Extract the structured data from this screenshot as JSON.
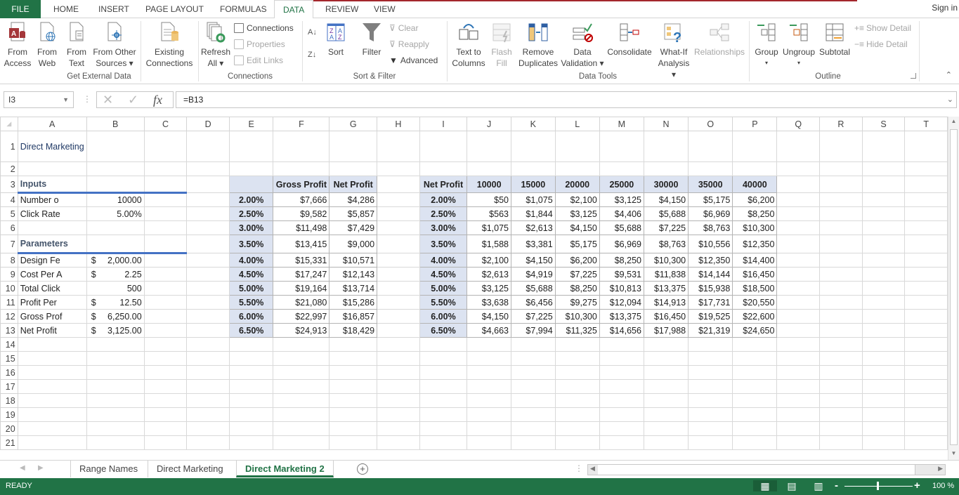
{
  "ribbon_tabs": [
    "FILE",
    "HOME",
    "INSERT",
    "PAGE LAYOUT",
    "FORMULAS",
    "DATA",
    "REVIEW",
    "VIEW"
  ],
  "active_tab": "DATA",
  "sign_in": "Sign in",
  "ribbon": {
    "get_external_data": {
      "label": "Get External Data",
      "from_access": [
        "From",
        "Access"
      ],
      "from_web": [
        "From",
        "Web"
      ],
      "from_text": [
        "From",
        "Text"
      ],
      "from_other": [
        "From Other",
        "Sources ▾"
      ],
      "existing": [
        "Existing",
        "Connections"
      ]
    },
    "connections": {
      "label": "Connections",
      "refresh_all": [
        "Refresh",
        "All ▾"
      ],
      "connections": "Connections",
      "properties": "Properties",
      "edit_links": "Edit Links"
    },
    "sort_filter": {
      "label": "Sort & Filter",
      "sort": "Sort",
      "filter": "Filter",
      "clear": "Clear",
      "reapply": "Reapply",
      "advanced": "Advanced"
    },
    "data_tools": {
      "label": "Data Tools",
      "text_to_columns": [
        "Text to",
        "Columns"
      ],
      "flash_fill": [
        "Flash",
        "Fill"
      ],
      "remove_duplicates": [
        "Remove",
        "Duplicates"
      ],
      "data_validation": [
        "Data",
        "Validation ▾"
      ],
      "consolidate": "Consolidate",
      "what_if": [
        "What-If",
        "Analysis ▾"
      ],
      "relationships": "Relationships"
    },
    "outline": {
      "label": "Outline",
      "group": [
        "Group",
        "▾"
      ],
      "ungroup": [
        "Ungroup",
        "▾"
      ],
      "subtotal": "Subtotal",
      "show_detail": "Show Detail",
      "hide_detail": "Hide Detail"
    }
  },
  "formula_bar": {
    "name_box": "I3",
    "formula": "=B13"
  },
  "columns": [
    "A",
    "B",
    "C",
    "D",
    "E",
    "F",
    "G",
    "H",
    "I",
    "J",
    "K",
    "L",
    "M",
    "N",
    "O",
    "P",
    "Q",
    "R",
    "S",
    "T"
  ],
  "rows": [
    "1",
    "2",
    "3",
    "4",
    "5",
    "6",
    "7",
    "8",
    "9",
    "10",
    "11",
    "12",
    "13",
    "14",
    "15",
    "16",
    "17",
    "18",
    "19",
    "20",
    "21"
  ],
  "sheet": {
    "title": "Direct Marketing",
    "inputs_header": "Inputs",
    "inputs": [
      {
        "label": "Number o",
        "dollar": "",
        "value": "10000"
      },
      {
        "label": "Click Rate",
        "dollar": "",
        "value": "5.00%"
      }
    ],
    "parameters_header": "Parameters",
    "parameters": [
      {
        "label": "Design Fe",
        "dollar": "$",
        "value": "2,000.00"
      },
      {
        "label": "Cost Per A",
        "dollar": "$",
        "value": "2.25"
      },
      {
        "label": "Total Click",
        "dollar": "",
        "value": "500"
      },
      {
        "label": "Profit Per",
        "dollar": "$",
        "value": "12.50"
      },
      {
        "label": "Gross Prof",
        "dollar": "$",
        "value": "6,250.00"
      },
      {
        "label": "Net Profit",
        "dollar": "$",
        "value": "3,125.00"
      }
    ],
    "one_way_table": {
      "headers": [
        "",
        "Gross Profit",
        "Net Profit"
      ],
      "rows": [
        [
          "2.00%",
          "$7,666",
          "$4,286"
        ],
        [
          "2.50%",
          "$9,582",
          "$5,857"
        ],
        [
          "3.00%",
          "$11,498",
          "$7,429"
        ],
        [
          "3.50%",
          "$13,415",
          "$9,000"
        ],
        [
          "4.00%",
          "$15,331",
          "$10,571"
        ],
        [
          "4.50%",
          "$17,247",
          "$12,143"
        ],
        [
          "5.00%",
          "$19,164",
          "$13,714"
        ],
        [
          "5.50%",
          "$21,080",
          "$15,286"
        ],
        [
          "6.00%",
          "$22,997",
          "$16,857"
        ],
        [
          "6.50%",
          "$24,913",
          "$18,429"
        ]
      ]
    },
    "two_way_table": {
      "headers": [
        "Net Profit",
        "10000",
        "15000",
        "20000",
        "25000",
        "30000",
        "35000",
        "40000"
      ],
      "rows": [
        [
          "2.00%",
          "$50",
          "$1,075",
          "$2,100",
          "$3,125",
          "$4,150",
          "$5,175",
          "$6,200"
        ],
        [
          "2.50%",
          "$563",
          "$1,844",
          "$3,125",
          "$4,406",
          "$5,688",
          "$6,969",
          "$8,250"
        ],
        [
          "3.00%",
          "$1,075",
          "$2,613",
          "$4,150",
          "$5,688",
          "$7,225",
          "$8,763",
          "$10,300"
        ],
        [
          "3.50%",
          "$1,588",
          "$3,381",
          "$5,175",
          "$6,969",
          "$8,763",
          "$10,556",
          "$12,350"
        ],
        [
          "4.00%",
          "$2,100",
          "$4,150",
          "$6,200",
          "$8,250",
          "$10,300",
          "$12,350",
          "$14,400"
        ],
        [
          "4.50%",
          "$2,613",
          "$4,919",
          "$7,225",
          "$9,531",
          "$11,838",
          "$14,144",
          "$16,450"
        ],
        [
          "5.00%",
          "$3,125",
          "$5,688",
          "$8,250",
          "$10,813",
          "$13,375",
          "$15,938",
          "$18,500"
        ],
        [
          "5.50%",
          "$3,638",
          "$6,456",
          "$9,275",
          "$12,094",
          "$14,913",
          "$17,731",
          "$20,550"
        ],
        [
          "6.00%",
          "$4,150",
          "$7,225",
          "$10,300",
          "$13,375",
          "$16,450",
          "$19,525",
          "$22,600"
        ],
        [
          "6.50%",
          "$4,663",
          "$7,994",
          "$11,325",
          "$14,656",
          "$17,988",
          "$21,319",
          "$24,650"
        ]
      ]
    }
  },
  "sheet_tabs": [
    "Range Names",
    "Direct Marketing",
    "Direct Marketing 2"
  ],
  "active_sheet": "Direct Marketing 2",
  "status": {
    "mode": "READY",
    "zoom": "100 %",
    "zoom_level_percent": 100
  },
  "colors": {
    "excel_green": "#217346",
    "header_fill": "#dce3f1",
    "title_color": "#1f3864",
    "accent_line": "#4472c4"
  }
}
